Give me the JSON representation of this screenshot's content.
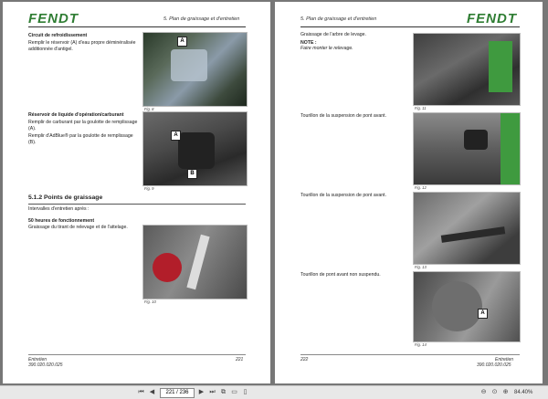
{
  "left_page": {
    "logo": "FENDT",
    "header": "5. Plan de graissage et d'entretien",
    "block1": {
      "title": "Circuit de refroidissement",
      "text": "Remplir le réservoir (A) d'eau propre déminéralisée additionnée d'antigel.",
      "caption": "Fig. 8",
      "marker": "A"
    },
    "block2": {
      "title": "Réservoir de liquide d'opération/carburant",
      "text1": "Remplir de carburant par la goulotte de remplissage (A).",
      "text2": "Remplir d'AdBlue® par la goulotte de remplissage (B).",
      "caption": "Fig. 9",
      "marker_a": "A",
      "marker_b": "B"
    },
    "section": {
      "title": "5.1.2  Points de graissage",
      "intro": "Intervalles d'entretien après :",
      "sub_title": "50 heures de fonctionnement",
      "sub_text": "Graissage du tirant de relevage et de l'attelage.",
      "caption": "Fig. 10"
    },
    "footer": {
      "title": "Entretien",
      "code": "390.020.020.025",
      "page": "221"
    }
  },
  "right_page": {
    "logo": "FENDT",
    "header": "5. Plan de graissage et d'entretien",
    "item1": {
      "text": "Graissage de l'arbre de levage.",
      "note_label": "NOTE :",
      "note_text": "Faire monter le relevage.",
      "caption": "Fig. 11"
    },
    "item2": {
      "text": "Tourillon de la suspension de pont avant.",
      "caption": "Fig. 12"
    },
    "item3": {
      "text": "Tourillon de la suspension de pont avant.",
      "caption": "Fig. 13"
    },
    "item4": {
      "text": "Tourillon de pont avant non suspendu.",
      "caption": "Fig. 14",
      "marker": "A"
    },
    "footer": {
      "page": "222",
      "title": "Entretien",
      "code": "390.020.020.025"
    }
  },
  "toolbar": {
    "current_page": "221 / 236",
    "total_label": "",
    "zoom": "84.40%"
  },
  "colors": {
    "brand_green": "#2f7d33",
    "viewer_bg": "#777777"
  }
}
